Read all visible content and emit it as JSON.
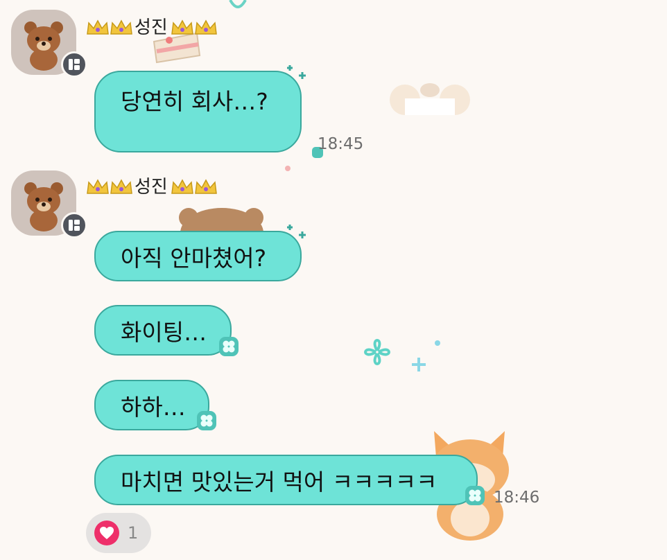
{
  "messages": [
    {
      "sender": "성진",
      "bubbles": [
        {
          "text": "당연히 회사…?"
        }
      ],
      "time": "18:45"
    },
    {
      "sender": "성진",
      "bubbles": [
        {
          "text": "아직 안마쳤어?"
        },
        {
          "text": "화이팅…"
        },
        {
          "text": "하하…"
        },
        {
          "text": "마치면 맛있는거 먹어 ㅋㅋㅋㅋㅋ"
        }
      ],
      "time": "18:46"
    }
  ],
  "reaction": {
    "icon": "heart-icon",
    "count": "1"
  },
  "colors": {
    "bubble": "#6ee3d7",
    "bubble_border": "#3aa89d",
    "heart": "#ee2f6a",
    "background": "#fcf8f4"
  }
}
